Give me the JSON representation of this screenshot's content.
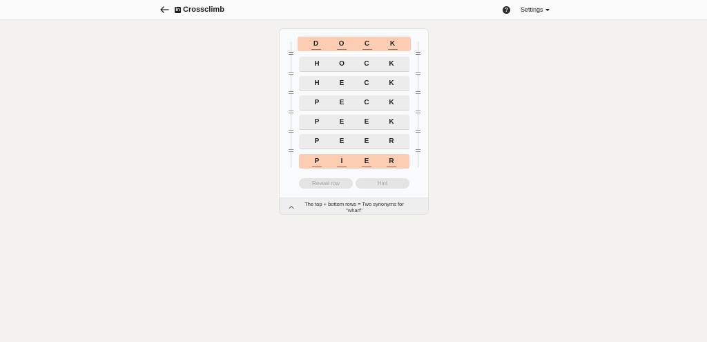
{
  "header": {
    "title": "Crossclimb",
    "logo_text": "in",
    "help_label": "?",
    "settings_label": "Settings"
  },
  "game": {
    "rows": [
      {
        "letters": [
          "D",
          "O",
          "C",
          "K"
        ],
        "state": "locked"
      },
      {
        "letters": [
          "H",
          "O",
          "C",
          "K"
        ],
        "state": "plain"
      },
      {
        "letters": [
          "H",
          "E",
          "C",
          "K"
        ],
        "state": "plain"
      },
      {
        "letters": [
          "P",
          "E",
          "C",
          "K"
        ],
        "state": "plain"
      },
      {
        "letters": [
          "P",
          "E",
          "E",
          "K"
        ],
        "state": "plain"
      },
      {
        "letters": [
          "P",
          "E",
          "E",
          "R"
        ],
        "state": "plain"
      },
      {
        "letters": [
          "P",
          "I",
          "E",
          "R"
        ],
        "state": "locked"
      }
    ],
    "buttons": {
      "reveal_row": "Reveal row",
      "hint": "Hint"
    },
    "clue": "The top + bottom rows = Two synonyms for \"wharf\""
  },
  "colors": {
    "locked_row": "#fdcdb3",
    "plain_row": "#ececec",
    "background": "#f3f2ef"
  }
}
